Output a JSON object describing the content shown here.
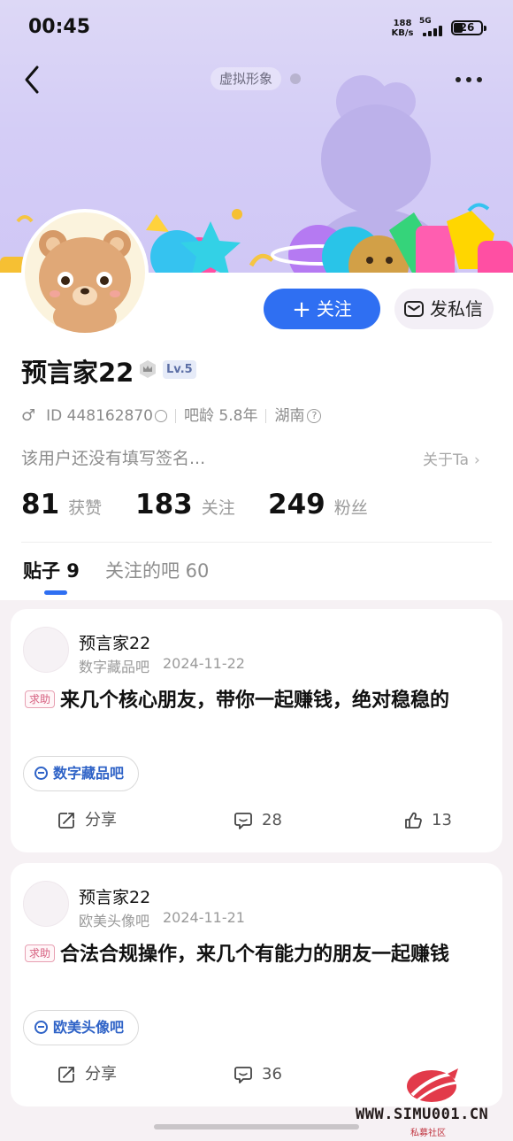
{
  "status_bar": {
    "time": "00:45",
    "net_speed_value": "188",
    "net_speed_unit": "KB/s",
    "network": "5G",
    "battery": "26"
  },
  "header": {
    "virtual_tag": "虚拟形象"
  },
  "profile": {
    "username": "预言家22",
    "level": "Lv.5",
    "gender_symbol": "♂",
    "id_text": "ID 448162870",
    "bar_age": "吧龄 5.8年",
    "location": "湖南",
    "signature": "该用户还没有填写签名...",
    "about_link": "关于Ta",
    "follow_button": "关注",
    "message_button": "发私信",
    "stats": [
      {
        "value": "81",
        "label": "获赞"
      },
      {
        "value": "183",
        "label": "关注"
      },
      {
        "value": "249",
        "label": "粉丝"
      }
    ]
  },
  "tabs": [
    {
      "label": "贴子 9"
    },
    {
      "label": "关注的吧 60"
    }
  ],
  "posts": [
    {
      "author": "预言家22",
      "forum": "数字藏品吧",
      "date": "2024-11-22",
      "tag": "求助",
      "title": "来几个核心朋友，带你一起赚钱，绝对稳稳的",
      "chip": "数字藏品吧",
      "share_label": "分享",
      "comments": "28",
      "likes": "13"
    },
    {
      "author": "预言家22",
      "forum": "欧美头像吧",
      "date": "2024-11-21",
      "tag": "求助",
      "title": "合法合规操作，来几个有能力的朋友一起赚钱",
      "chip": "欧美头像吧",
      "share_label": "分享",
      "comments": "36",
      "likes": ""
    }
  ],
  "watermark": {
    "url": "WWW.SIMU001.CN",
    "sub": "私募社区"
  },
  "colors": {
    "accent_blue": "#2f6ff2",
    "banner": "#d4cdf6",
    "help_tag": "#d65f7f"
  }
}
